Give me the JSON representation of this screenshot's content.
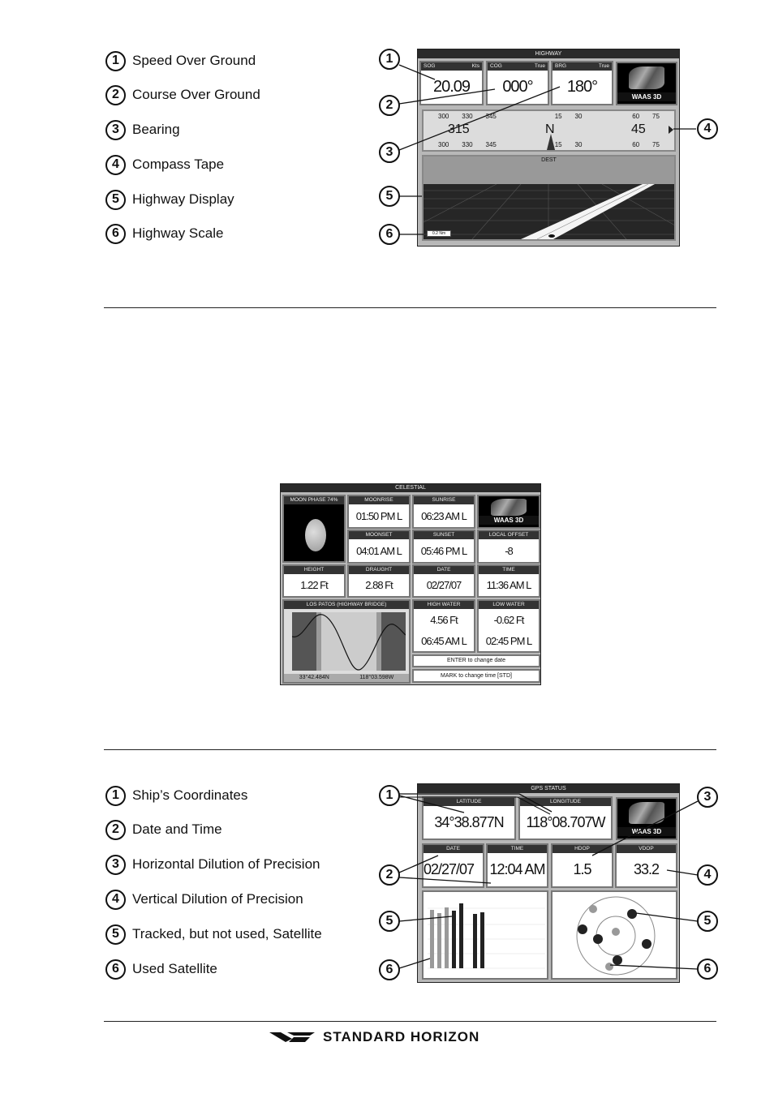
{
  "section1": {
    "items": [
      {
        "n": "1",
        "label": "Speed Over Ground"
      },
      {
        "n": "2",
        "label": "Course Over Ground"
      },
      {
        "n": "3",
        "label": "Bearing"
      },
      {
        "n": "4",
        "label": "Compass Tape"
      },
      {
        "n": "5",
        "label": "Highway Display"
      },
      {
        "n": "6",
        "label": "Highway Scale"
      }
    ]
  },
  "highway": {
    "title": "HIGHWAY",
    "sog": {
      "label": "SOG",
      "unit": "Kts",
      "value": "20.09"
    },
    "cog": {
      "label": "COG",
      "unit": "True",
      "value": "000°"
    },
    "brg": {
      "label": "BRG",
      "unit": "True",
      "value": "180°"
    },
    "waas": "WAAS 3D",
    "compass": {
      "top_ticks": [
        "300",
        "330",
        "345",
        "15",
        "30",
        "60",
        "75"
      ],
      "bottom_ticks": [
        "300",
        "330",
        "345",
        "15",
        "30",
        "60",
        "75"
      ],
      "left_big": "315",
      "center": "N",
      "right_big": "45"
    },
    "dest": "DEST",
    "scale": "0.2 Nm"
  },
  "celestial": {
    "title": "CELESTIAL",
    "moon_phase": "MOON PHASE 74%",
    "moonrise": {
      "label": "MOONRISE",
      "value": "01:50 PM L"
    },
    "sunrise": {
      "label": "SUNRISE",
      "value": "06:23 AM L"
    },
    "waas": "WAAS 3D",
    "moonset": {
      "label": "MOONSET",
      "value": "04:01 AM L"
    },
    "sunset": {
      "label": "SUNSET",
      "value": "05:46 PM L"
    },
    "local_offset": {
      "label": "LOCAL OFFSET",
      "value": "-8"
    },
    "height": {
      "label": "HEIGHT",
      "value": "1.22 Ft"
    },
    "draught": {
      "label": "DRAUGHT",
      "value": "2.88 Ft"
    },
    "date": {
      "label": "DATE",
      "value": "02/27/07"
    },
    "time": {
      "label": "TIME",
      "value": "11:36 AM L"
    },
    "tide_station": "LOS PATOS (HIGHWAY BRIDGE)",
    "lat": "33°42.484N",
    "lon": "118°03.598W",
    "high_water": {
      "label": "HIGH WATER",
      "height": "4.56 Ft",
      "time": "06:45 AM L"
    },
    "low_water": {
      "label": "LOW WATER",
      "height": "-0.62 Ft",
      "time": "02:45 PM L"
    },
    "hint1": "ENTER to change date",
    "hint2": "MARK to change time [STD]"
  },
  "section2": {
    "items": [
      {
        "n": "1",
        "label": "Ship’s Coordinates"
      },
      {
        "n": "2",
        "label": "Date and Time"
      },
      {
        "n": "3",
        "label": "Horizontal Dilution of Precision"
      },
      {
        "n": "4",
        "label": "Vertical Dilution of Precision"
      },
      {
        "n": "5",
        "label": "Tracked, but not used, Satellite"
      },
      {
        "n": "6",
        "label": "Used Satellite"
      }
    ]
  },
  "gps": {
    "title": "GPS STATUS",
    "latitude": {
      "label": "LATITUDE",
      "value": "34°38.877N"
    },
    "longitude": {
      "label": "LONGITUDE",
      "value": "118°08.707W"
    },
    "waas": "WAAS 3D",
    "date": {
      "label": "DATE",
      "value": "02/27/07"
    },
    "time": {
      "label": "TIME",
      "value": "12:04 AM"
    },
    "hdop": {
      "label": "HDOP",
      "value": "1.5"
    },
    "vdop": {
      "label": "VDOP",
      "value": "33.2"
    }
  },
  "callouts": {
    "c1": "1",
    "c2": "2",
    "c3": "3",
    "c4": "4",
    "c5": "5",
    "c6": "6"
  },
  "footer": {
    "brand": "STANDARD HORIZON"
  }
}
